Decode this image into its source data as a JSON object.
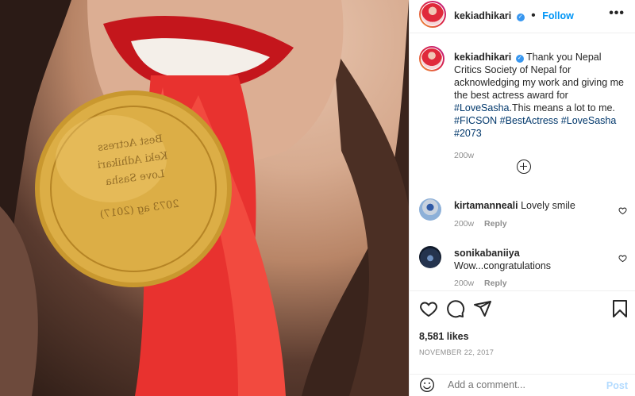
{
  "post": {
    "username": "kekiadhikari",
    "follow_label": "Follow",
    "more_label": "•••",
    "caption": {
      "username": "kekiadhikari",
      "text_parts": [
        {
          "text": "Thank you Nepal Critics Society of Nepal for acknowledging my work and giving me the best actress award for "
        },
        {
          "text": "#LoveSasha",
          "link": true
        },
        {
          "text": ".This means a lot to me. "
        },
        {
          "text": "#FICSON",
          "link": true
        },
        {
          "text": " "
        },
        {
          "text": "#BestActress",
          "link": true
        },
        {
          "text": " "
        },
        {
          "text": "#LoveSasha",
          "link": true
        },
        {
          "text": " "
        },
        {
          "text": "#2073",
          "link": true
        }
      ],
      "time": "200w"
    },
    "comments": [
      {
        "username": "kirtamanneali",
        "text": "Lovely smile",
        "time": "200w",
        "reply": "Reply"
      },
      {
        "username": "sonikabaniiya",
        "text": "Wow...congratulations",
        "time": "200w",
        "reply": "Reply"
      }
    ],
    "likes": "8,581 likes",
    "date": "NOVEMBER 22, 2017",
    "add_comment_placeholder": "Add a comment...",
    "post_label": "Post"
  },
  "medal": {
    "lines": [
      "Best Actress",
      "Keki Adhikari",
      "Love Sasha",
      "2073 ag (2017)"
    ]
  },
  "colors": {
    "link": "#00376b",
    "follow": "#0095f6",
    "verified": "#3897f0",
    "ribbon": "#e8322f",
    "gold": "#d9a93f"
  },
  "icons": [
    "heart-icon",
    "comment-icon",
    "share-icon",
    "bookmark-icon",
    "add-comment-plus-icon",
    "emoji-icon",
    "verified-icon",
    "more-options-icon"
  ]
}
